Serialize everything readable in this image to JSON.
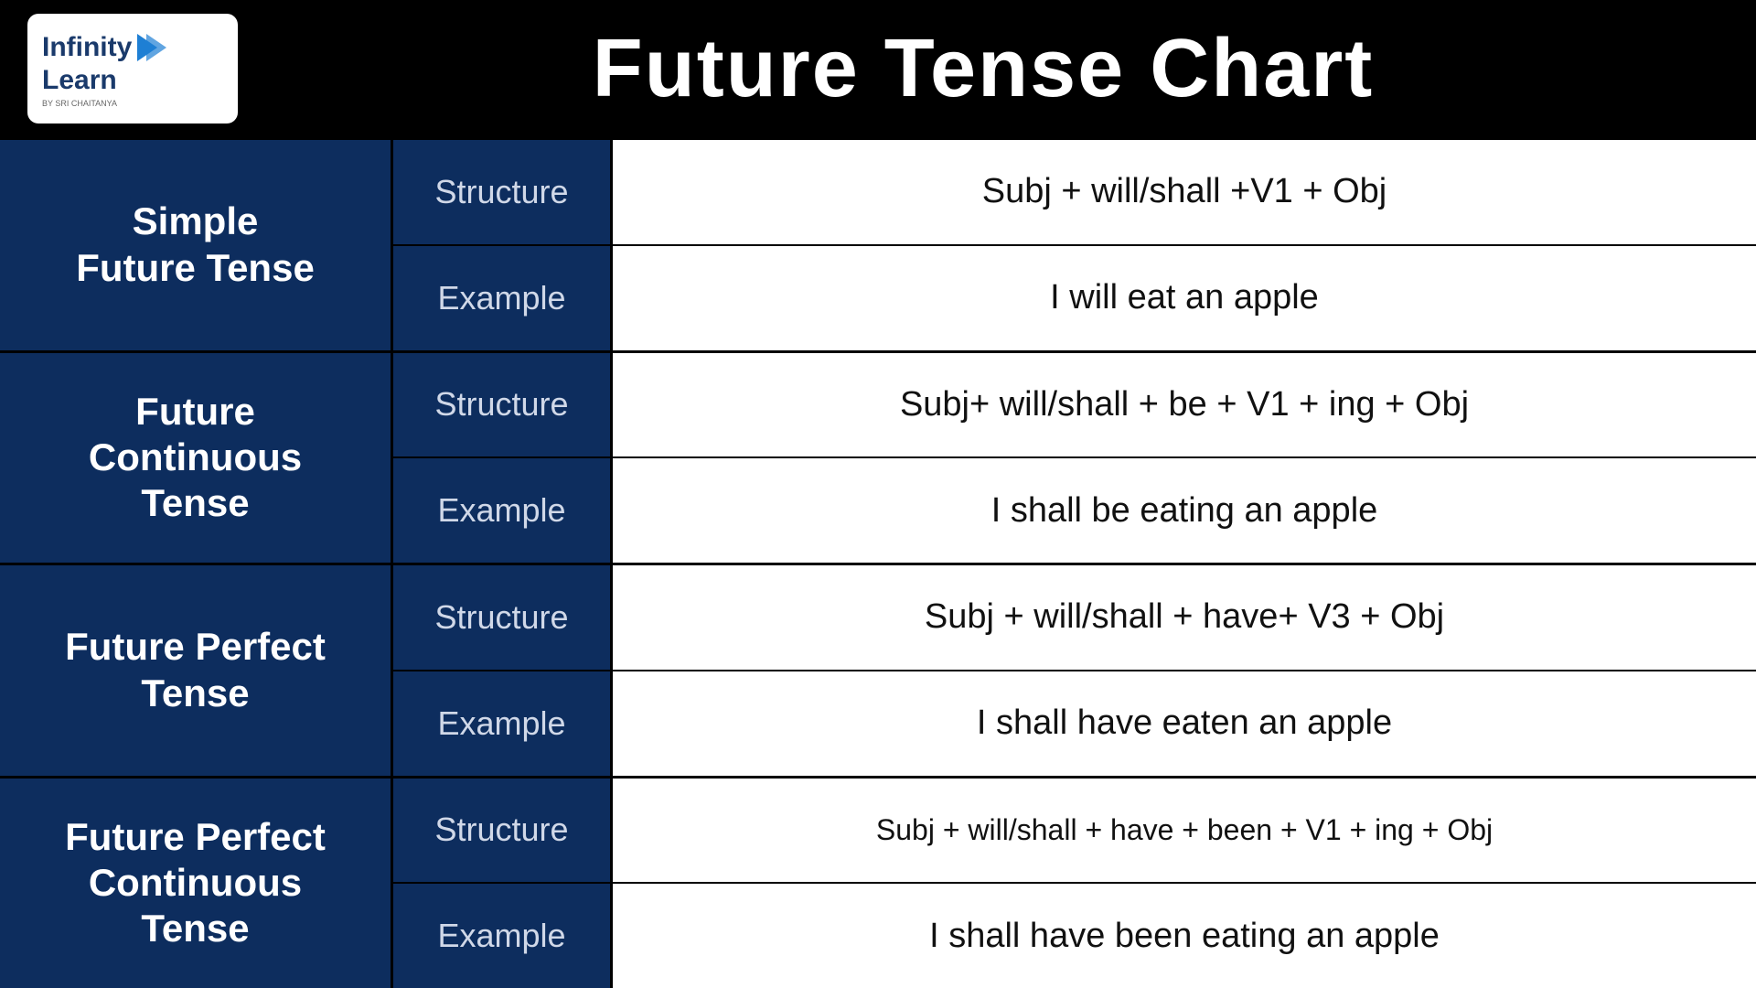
{
  "header": {
    "title": "Future Tense Chart",
    "logo": {
      "infinity": "Infinity",
      "learn": "Learn",
      "sub": "BY SRI CHAITANYA"
    }
  },
  "table": {
    "rows": [
      {
        "name": "Simple\nFuture Tense",
        "structure": "Subj + will/shall +V1 + Obj",
        "example": "I will eat an apple"
      },
      {
        "name": "Future\nContinuous\nTense",
        "structure": "Subj+ will/shall + be + V1 + ing + Obj",
        "example": "I shall be eating an apple"
      },
      {
        "name": "Future Perfect\nTense",
        "structure": "Subj + will/shall + have+ V3 + Obj",
        "example": "I shall have eaten an apple"
      },
      {
        "name": "Future Perfect\nContinuous\nTense",
        "structure": "Subj + will/shall + have + been + V1 + ing + Obj",
        "example": "I shall have been eating an apple"
      }
    ],
    "labels": {
      "structure": "Structure",
      "example": "Example"
    }
  }
}
